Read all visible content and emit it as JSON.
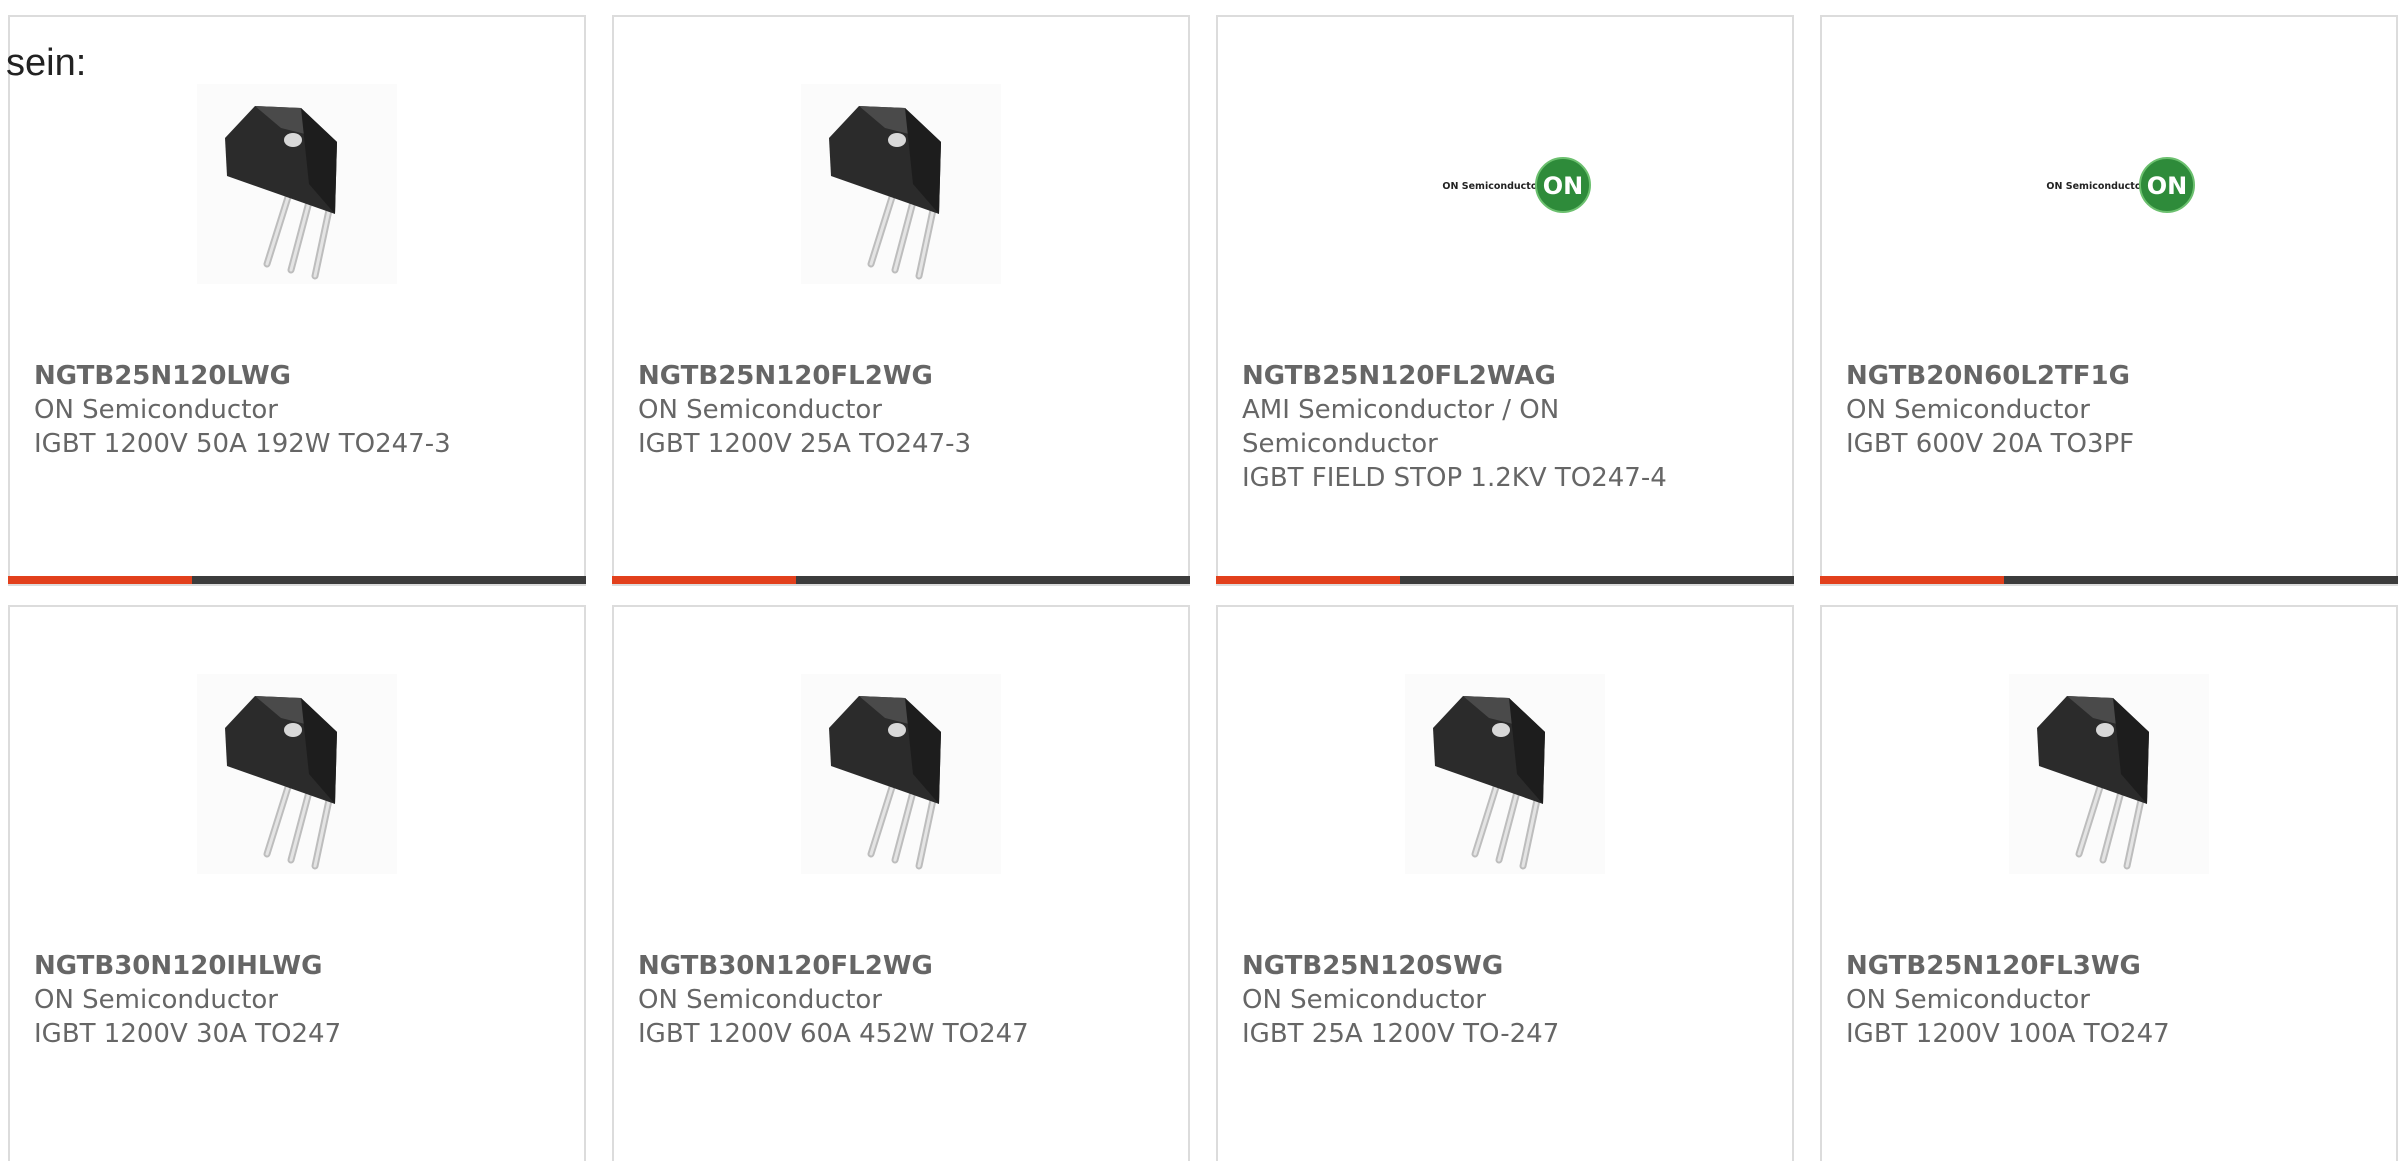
{
  "intro_text": "sein:",
  "colors": {
    "accent": "#e2401c",
    "bar": "#3c3c3c",
    "border": "#dcdcdc",
    "text": "#666666",
    "on_logo_green": "#2e8b3a"
  },
  "products": [
    {
      "part": "NGTB25N120LWG",
      "maker": "ON Semiconductor",
      "desc": "IGBT 1200V 50A 192W TO247-3",
      "image": "to247-transistor-icon"
    },
    {
      "part": "NGTB25N120FL2WG",
      "maker": "ON Semiconductor",
      "desc": "IGBT 1200V 25A TO247-3",
      "image": "to247-transistor-icon"
    },
    {
      "part": "NGTB25N120FL2WAG",
      "maker": "AMI Semiconductor / ON Semiconductor",
      "desc": "IGBT FIELD STOP 1.2KV TO247-4",
      "image": "on-semiconductor-logo",
      "logo_text": "ON Semiconductor®",
      "logo_badge": "ON"
    },
    {
      "part": "NGTB20N60L2TF1G",
      "maker": "ON Semiconductor",
      "desc": "IGBT 600V 20A TO3PF",
      "image": "on-semiconductor-logo",
      "logo_text": "ON Semiconductor®",
      "logo_badge": "ON"
    },
    {
      "part": "NGTB30N120IHLWG",
      "maker": "ON Semiconductor",
      "desc": "IGBT 1200V 30A TO247",
      "image": "to247-transistor-icon"
    },
    {
      "part": "NGTB30N120FL2WG",
      "maker": "ON Semiconductor",
      "desc": "IGBT 1200V 60A 452W TO247",
      "image": "to247-transistor-icon"
    },
    {
      "part": "NGTB25N120SWG",
      "maker": "ON Semiconductor",
      "desc": "IGBT 25A 1200V TO-247",
      "image": "to247-transistor-icon"
    },
    {
      "part": "NGTB25N120FL3WG",
      "maker": "ON Semiconductor",
      "desc": "IGBT 1200V 100A TO247",
      "image": "to247-transistor-icon"
    }
  ]
}
